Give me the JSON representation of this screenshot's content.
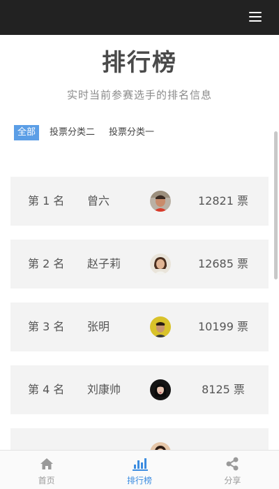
{
  "header": {
    "menu_icon": "hamburger-menu-icon"
  },
  "page": {
    "title": "排行榜",
    "subtitle": "实时当前参赛选手的排名信息"
  },
  "tabs": [
    {
      "label": "全部",
      "active": true
    },
    {
      "label": "投票分类二",
      "active": false
    },
    {
      "label": "投票分类一",
      "active": false
    }
  ],
  "ranking": [
    {
      "rank_label": "第 1 名",
      "name": "曾六",
      "votes": "12821 票",
      "avatar_icon": "avatar-icon"
    },
    {
      "rank_label": "第 2 名",
      "name": "赵子莉",
      "votes": "12685 票",
      "avatar_icon": "avatar-icon"
    },
    {
      "rank_label": "第 3 名",
      "name": "张明",
      "votes": "10199 票",
      "avatar_icon": "avatar-icon"
    },
    {
      "rank_label": "第 4 名",
      "name": "刘康帅",
      "votes": "8125 票",
      "avatar_icon": "avatar-icon"
    }
  ],
  "bottom_nav": [
    {
      "label": "首页",
      "icon": "home-icon",
      "active": false
    },
    {
      "label": "排行榜",
      "icon": "bar-chart-icon",
      "active": true
    },
    {
      "label": "分享",
      "icon": "share-icon",
      "active": false
    }
  ],
  "colors": {
    "topbar": "#222222",
    "accent": "#3b8ce0",
    "tab_active": "#5b9ee6",
    "row_bg": "#f3f3f3"
  }
}
